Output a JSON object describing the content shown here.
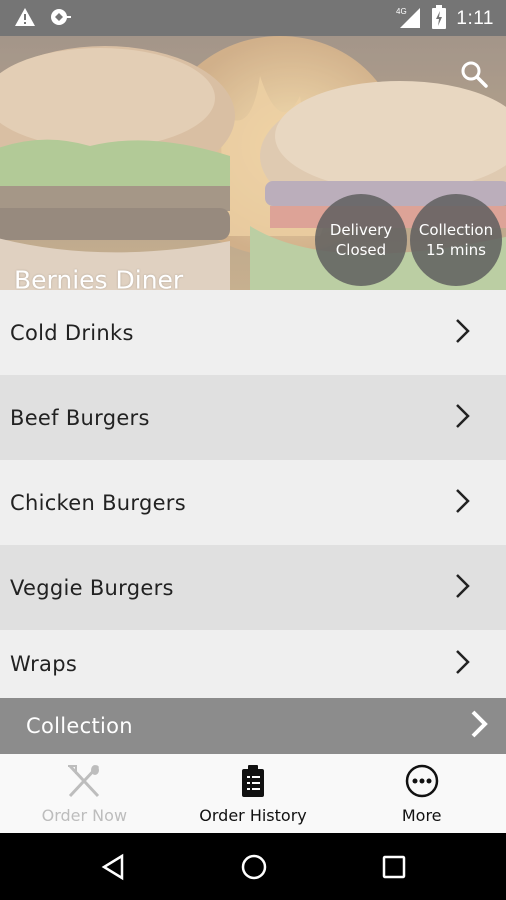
{
  "status_bar": {
    "time": "1:11",
    "network": "4G",
    "icons": [
      "warning-icon",
      "notification-icon",
      "signal-icon",
      "battery-charging-icon"
    ]
  },
  "hero": {
    "restaurant_name": "Bernies Diner",
    "delivery": {
      "line1": "Delivery",
      "line2": "Closed"
    },
    "collection": {
      "line1": "Collection",
      "line2": "15 mins"
    },
    "search_icon": "search-icon"
  },
  "menu": {
    "items": [
      {
        "label": "Cold Drinks"
      },
      {
        "label": "Beef Burgers"
      },
      {
        "label": "Chicken Burgers"
      },
      {
        "label": "Veggie Burgers"
      },
      {
        "label": "Wraps"
      }
    ]
  },
  "order_mode_bar": {
    "label": "Collection"
  },
  "tabs": [
    {
      "label": "Order Now",
      "icon": "fork-knife-icon",
      "active": false
    },
    {
      "label": "Order History",
      "icon": "clipboard-icon",
      "active": true
    },
    {
      "label": "More",
      "icon": "more-icon",
      "active": true
    }
  ],
  "colors": {
    "status_bar": "#757575",
    "collection_bar": "#8c8c8c",
    "badge": "#5f5f5f",
    "row_light": "#efefef",
    "row_dark": "#e0e0e0"
  }
}
